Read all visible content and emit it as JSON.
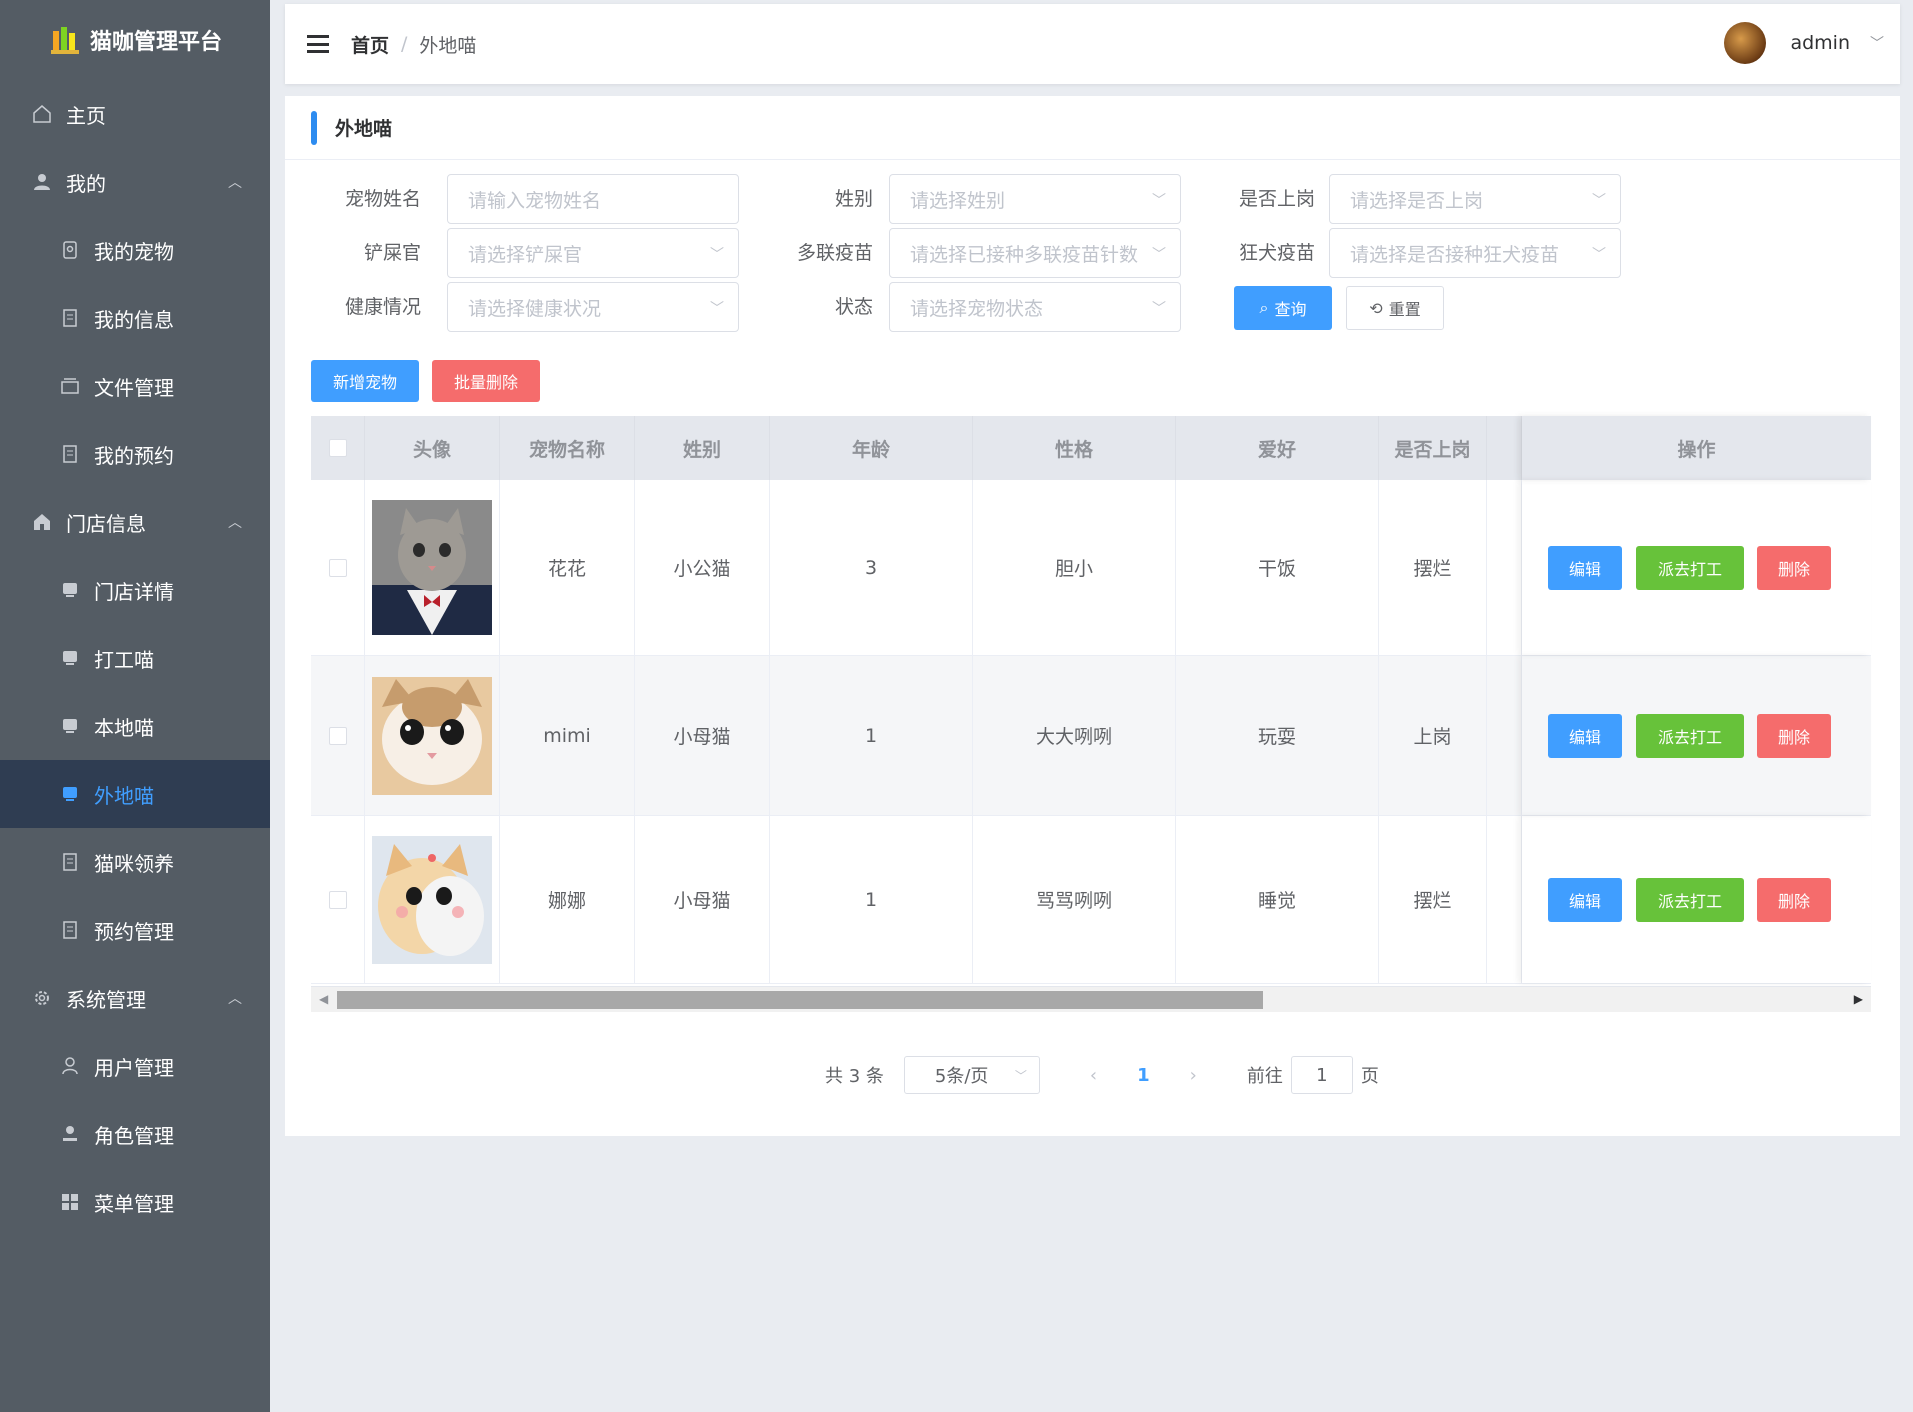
{
  "brand": {
    "title": "猫咖管理平台"
  },
  "sidebar": {
    "items": [
      {
        "label": "主页"
      },
      {
        "label": "我的"
      },
      {
        "label": "我的宠物"
      },
      {
        "label": "我的信息"
      },
      {
        "label": "文件管理"
      },
      {
        "label": "我的预约"
      },
      {
        "label": "门店信息"
      },
      {
        "label": "门店详情"
      },
      {
        "label": "打工喵"
      },
      {
        "label": "本地喵"
      },
      {
        "label": "外地喵"
      },
      {
        "label": "猫咪领养"
      },
      {
        "label": "预约管理"
      },
      {
        "label": "系统管理"
      },
      {
        "label": "用户管理"
      },
      {
        "label": "角色管理"
      },
      {
        "label": "菜单管理"
      }
    ]
  },
  "header": {
    "breadcrumb_home": "首页",
    "breadcrumb_sep": "/",
    "breadcrumb_current": "外地喵",
    "username": "admin"
  },
  "card": {
    "title": "外地喵"
  },
  "filters": {
    "pet_name": {
      "label": "宠物姓名",
      "placeholder": "请输入宠物姓名"
    },
    "gender": {
      "label": "姓别",
      "placeholder": "请选择姓别"
    },
    "on_duty": {
      "label": "是否上岗",
      "placeholder": "请选择是否上岗"
    },
    "owner": {
      "label": "铲屎官",
      "placeholder": "请选择铲屎官"
    },
    "multi_vaccine": {
      "label": "多联疫苗",
      "placeholder": "请选择已接种多联疫苗针数"
    },
    "rabies": {
      "label": "狂犬疫苗",
      "placeholder": "请选择是否接种狂犬疫苗"
    },
    "health": {
      "label": "健康情况",
      "placeholder": "请选择健康状况"
    },
    "status": {
      "label": "状态",
      "placeholder": "请选择宠物状态"
    },
    "query_label": "查询",
    "reset_label": "重置"
  },
  "toolbar": {
    "add_label": "新增宠物",
    "batch_delete_label": "批量删除"
  },
  "table": {
    "headers": [
      "头像",
      "宠物名称",
      "姓别",
      "年龄",
      "性格",
      "爱好",
      "是否上岗",
      "操作"
    ],
    "rows": [
      {
        "name": "花花",
        "gender": "小公猫",
        "age": "3",
        "personality": "胆小",
        "hobby": "干饭",
        "on_duty": "摆烂"
      },
      {
        "name": "mimi",
        "gender": "小母猫",
        "age": "1",
        "personality": "大大咧咧",
        "hobby": "玩耍",
        "on_duty": "上岗"
      },
      {
        "name": "娜娜",
        "gender": "小母猫",
        "age": "1",
        "personality": "骂骂咧咧",
        "hobby": "睡觉",
        "on_duty": "摆烂"
      }
    ],
    "action_edit": "编辑",
    "action_dispatch": "派去打工",
    "action_delete": "删除"
  },
  "pagination": {
    "total_text": "共 3 条",
    "page_size": "5条/页",
    "current_page": "1",
    "goto_prefix": "前往",
    "goto_value": "1",
    "goto_suffix": "页"
  },
  "colors": {
    "primary": "#409eff",
    "danger": "#f56c6c",
    "success": "#67c23a",
    "sidebar": "#545c64"
  }
}
